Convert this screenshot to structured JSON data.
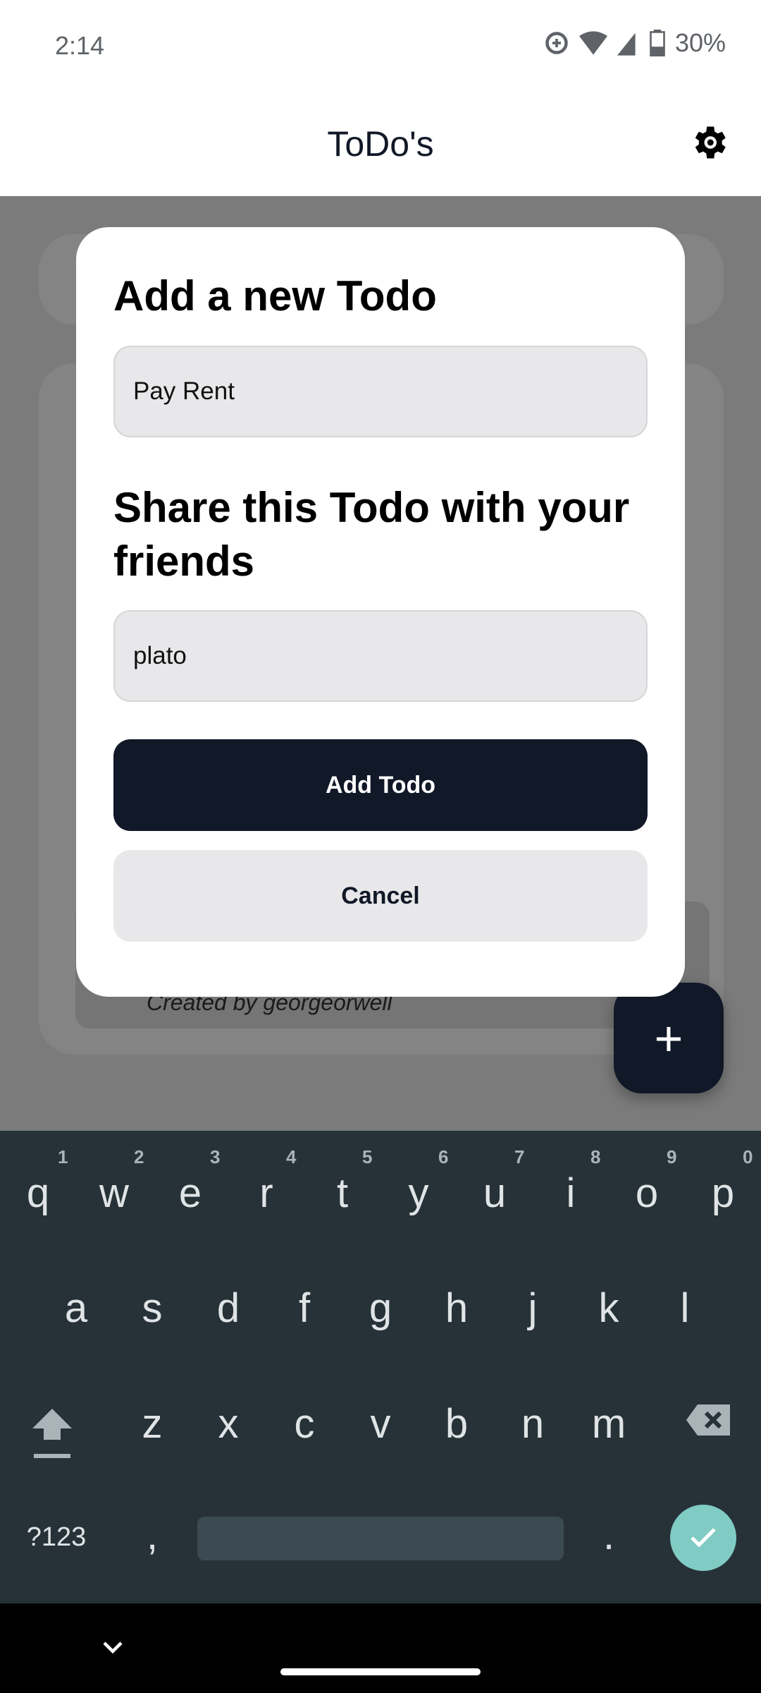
{
  "status_bar": {
    "time": "2:14",
    "battery": "30%",
    "icons": [
      "data-saver-icon",
      "wifi-icon",
      "signal-icon",
      "battery-icon"
    ]
  },
  "header": {
    "title": "ToDo's",
    "settings_icon": "gear-icon"
  },
  "background": {
    "todo_creator": "Created by georgeorwell",
    "fab_icon": "plus-icon"
  },
  "dialog": {
    "title": "Add a new Todo",
    "todo_value": "Pay Rent",
    "share_title": "Share this Todo with your friends",
    "share_value": "plato",
    "add_label": "Add Todo",
    "cancel_label": "Cancel"
  },
  "keyboard": {
    "row1": [
      "q",
      "w",
      "e",
      "r",
      "t",
      "y",
      "u",
      "i",
      "o",
      "p"
    ],
    "nums": [
      "1",
      "2",
      "3",
      "4",
      "5",
      "6",
      "7",
      "8",
      "9",
      "0"
    ],
    "row2": [
      "a",
      "s",
      "d",
      "f",
      "g",
      "h",
      "j",
      "k",
      "l"
    ],
    "row3": [
      "z",
      "x",
      "c",
      "v",
      "b",
      "n",
      "m"
    ],
    "symbols": "?123",
    "comma": ",",
    "period": ".",
    "accent": "#80cbc4"
  },
  "colors": {
    "primary": "#111827",
    "input_bg": "#e8e8ea",
    "keyboard_bg": "#263238"
  }
}
